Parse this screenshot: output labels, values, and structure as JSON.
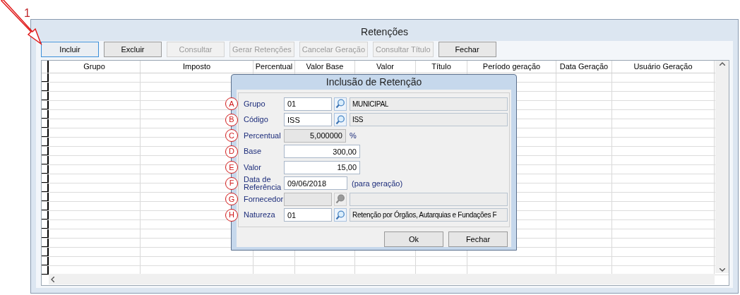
{
  "annotation": {
    "label": "1"
  },
  "window": {
    "title": "Retenções"
  },
  "toolbar": [
    {
      "label": "Incluir",
      "disabled": false,
      "focused": true
    },
    {
      "label": "Excluir",
      "disabled": false,
      "focused": false
    },
    {
      "label": "Consultar",
      "disabled": true,
      "focused": false
    },
    {
      "label": "Gerar Retenções",
      "disabled": true,
      "focused": false
    },
    {
      "label": "Cancelar Geração",
      "disabled": true,
      "focused": false
    },
    {
      "label": "Consultar Título",
      "disabled": true,
      "focused": false
    },
    {
      "label": "Fechar",
      "disabled": false,
      "focused": false
    }
  ],
  "table": {
    "columns": [
      "Grupo",
      "Imposto",
      "Percentual",
      "Valor Base",
      "Valor",
      "Título",
      "Período geração",
      "Data Geração",
      "Usuário Geração"
    ]
  },
  "dialog": {
    "title": "Inclusão de Retenção",
    "fields": [
      {
        "marker": "A",
        "label": "Grupo",
        "kind": "lookup",
        "disabled": false,
        "value": "01",
        "description": "MUNICIPAL"
      },
      {
        "marker": "B",
        "label": "Código",
        "kind": "lookup",
        "disabled": false,
        "value": "ISS",
        "description": "ISS"
      },
      {
        "marker": "C",
        "label": "Percentual",
        "kind": "readonly",
        "disabled": true,
        "value": "5,000000",
        "suffix": "%"
      },
      {
        "marker": "D",
        "label": "Base",
        "kind": "number",
        "disabled": false,
        "value": "300,00"
      },
      {
        "marker": "E",
        "label": "Valor",
        "kind": "number",
        "disabled": false,
        "value": "15,00"
      },
      {
        "marker": "F",
        "label": "Data de Referência",
        "kind": "date",
        "disabled": false,
        "value": "09/06/2018",
        "suffix": "(para geração)"
      },
      {
        "marker": "G",
        "label": "Fornecedor",
        "kind": "lookup",
        "disabled": true
      },
      {
        "marker": "H",
        "label": "Natureza",
        "kind": "lookup",
        "disabled": false,
        "value": "01",
        "description": "Retenção por Órgãos, Autarquias e Fundações F"
      }
    ],
    "buttons": [
      "Ok",
      "Fechar"
    ]
  }
}
